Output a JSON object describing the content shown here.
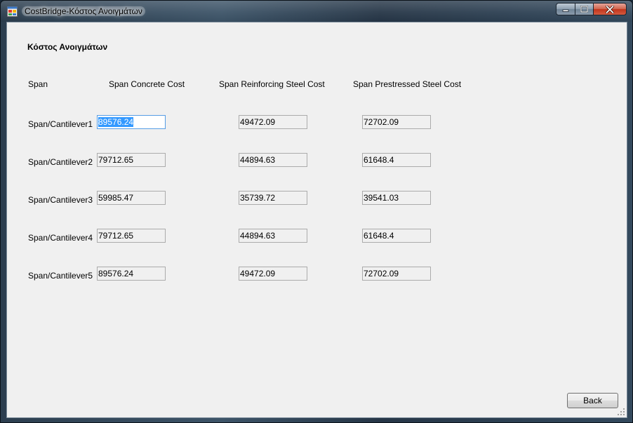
{
  "window": {
    "title": "CostBridge-Κόστος Ανοιγμάτων"
  },
  "form": {
    "title": "Κόστος Ανοιγμάτων",
    "headers": {
      "span": "Span",
      "concrete": "Span Concrete Cost",
      "reinforcing": "Span Reinforcing Steel Cost",
      "prestressed": "Span Prestressed Steel Cost"
    },
    "rows": [
      {
        "label": "Span/Cantilever1",
        "concrete": "89576.24",
        "reinforcing": "49472.09",
        "prestressed": "72702.09"
      },
      {
        "label": "Span/Cantilever2",
        "concrete": "79712.65",
        "reinforcing": "44894.63",
        "prestressed": "61648.4"
      },
      {
        "label": "Span/Cantilever3",
        "concrete": "59985.47",
        "reinforcing": "35739.72",
        "prestressed": "39541.03"
      },
      {
        "label": "Span/Cantilever4",
        "concrete": "79712.65",
        "reinforcing": "44894.63",
        "prestressed": "61648.4"
      },
      {
        "label": "Span/Cantilever5",
        "concrete": "89576.24",
        "reinforcing": "49472.09",
        "prestressed": "72702.09"
      }
    ],
    "back_label": "Back"
  },
  "icons": {
    "app": "app-window-icon",
    "minimize": "minimize-icon",
    "maximize": "maximize-icon",
    "close": "close-icon"
  },
  "colors": {
    "client_bg": "#f0f0f0",
    "selection": "#3399ff",
    "close_button": "#c2351c"
  }
}
